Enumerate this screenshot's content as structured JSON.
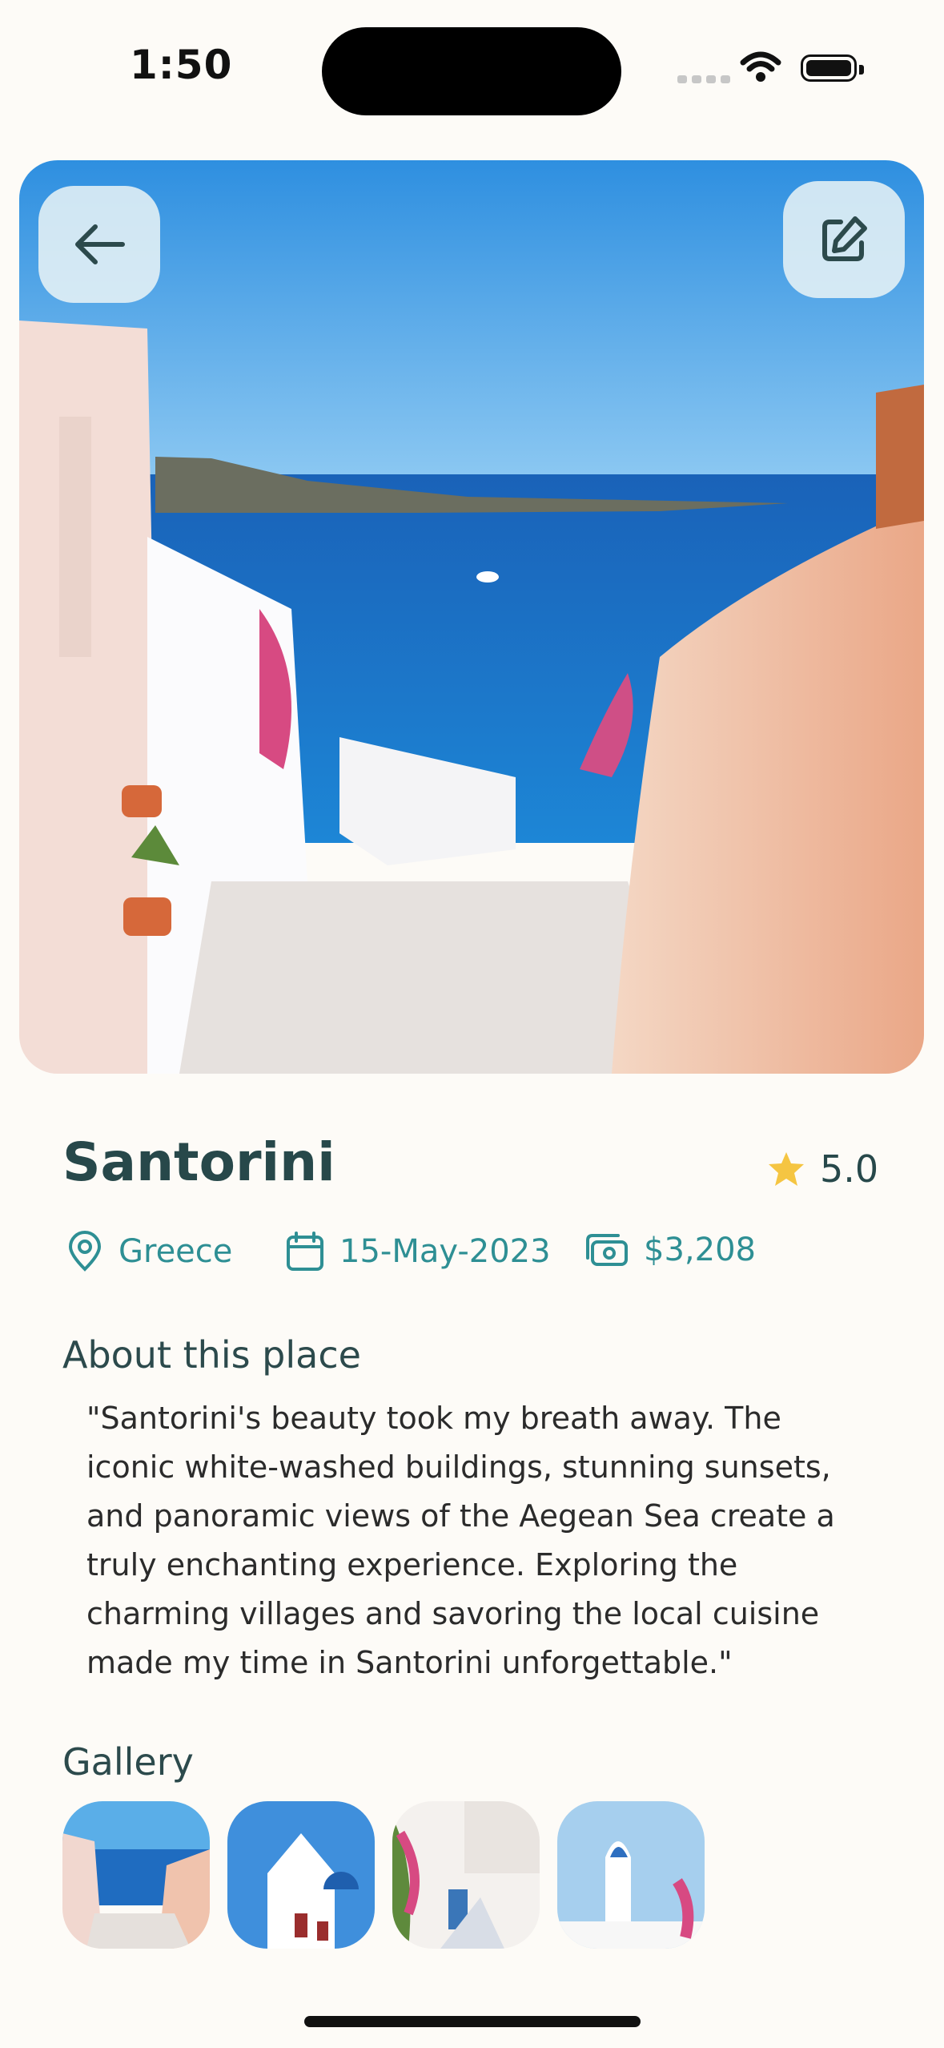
{
  "status_bar": {
    "time": "1:50"
  },
  "header": {
    "back_icon": "arrow-left-icon",
    "edit_icon": "edit-square-icon"
  },
  "place": {
    "title": "Santorini",
    "rating": "5.0",
    "location": "Greece",
    "date": "15-May-2023",
    "cost": "$3,208"
  },
  "about": {
    "heading": "About this place",
    "text": "\"Santorini's beauty took my breath away. The iconic white-washed buildings, stunning sunsets, and panoramic views of the Aegean Sea create a truly enchanting experience. Exploring the charming villages and savoring the local cuisine made my time in Santorini unforgettable.\""
  },
  "gallery": {
    "heading": "Gallery",
    "count": 4
  },
  "colors": {
    "accent": "#2e8f94",
    "title": "#27484a",
    "star": "#f5c542",
    "background": "#fdfbf7"
  }
}
